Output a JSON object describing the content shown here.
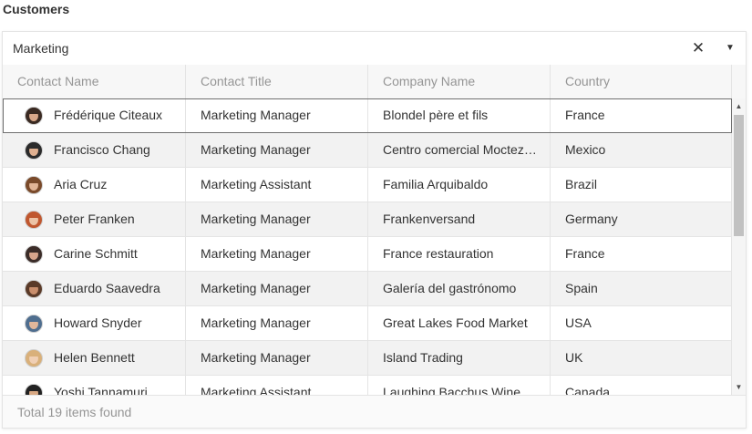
{
  "title": "Customers",
  "combo": {
    "value": "Marketing",
    "clear_glyph": "✕",
    "dropdown_glyph": "▼"
  },
  "grid": {
    "columns": [
      "Contact Name",
      "Contact Title",
      "Company Name",
      "Country"
    ],
    "rows": [
      {
        "name": "Frédérique Citeaux",
        "title": "Marketing Manager",
        "company": "Blondel père et fils",
        "country": "France",
        "avatar": {
          "hair": "#3a2a22",
          "face": "#d9a88a"
        }
      },
      {
        "name": "Francisco Chang",
        "title": "Marketing Manager",
        "company": "Centro comercial Moctezuma",
        "country": "Mexico",
        "avatar": {
          "hair": "#2b2b2b",
          "face": "#e0b090"
        }
      },
      {
        "name": "Aria Cruz",
        "title": "Marketing Assistant",
        "company": "Familia Arquibaldo",
        "country": "Brazil",
        "avatar": {
          "hair": "#7a4a2a",
          "face": "#e2b596"
        }
      },
      {
        "name": "Peter Franken",
        "title": "Marketing Manager",
        "company": "Frankenversand",
        "country": "Germany",
        "avatar": {
          "hair": "#c0572f",
          "face": "#ecc3a6"
        }
      },
      {
        "name": "Carine Schmitt",
        "title": "Marketing Manager",
        "company": "France restauration",
        "country": "France",
        "avatar": {
          "hair": "#3b2c28",
          "face": "#d8a58c"
        }
      },
      {
        "name": "Eduardo Saavedra",
        "title": "Marketing Manager",
        "company": "Galería del gastrónomo",
        "country": "Spain",
        "avatar": {
          "hair": "#5a3a28",
          "face": "#c98e6c"
        }
      },
      {
        "name": "Howard Snyder",
        "title": "Marketing Manager",
        "company": "Great Lakes Food Market",
        "country": "USA",
        "avatar": {
          "hair": "#4f6e8f",
          "face": "#e1b79b"
        }
      },
      {
        "name": "Helen Bennett",
        "title": "Marketing Manager",
        "company": "Island Trading",
        "country": "UK",
        "avatar": {
          "hair": "#d9b07a",
          "face": "#f0cfb4"
        }
      },
      {
        "name": "Yoshi Tannamuri",
        "title": "Marketing Assistant",
        "company": "Laughing Bacchus Wine Cellars",
        "country": "Canada",
        "avatar": {
          "hair": "#222222",
          "face": "#d8a883"
        }
      }
    ],
    "focused_row": 0,
    "scroll": {
      "up_glyph": "▲",
      "down_glyph": "▼",
      "position": 0.0
    }
  },
  "footer": {
    "status": "Total 19 items found"
  }
}
